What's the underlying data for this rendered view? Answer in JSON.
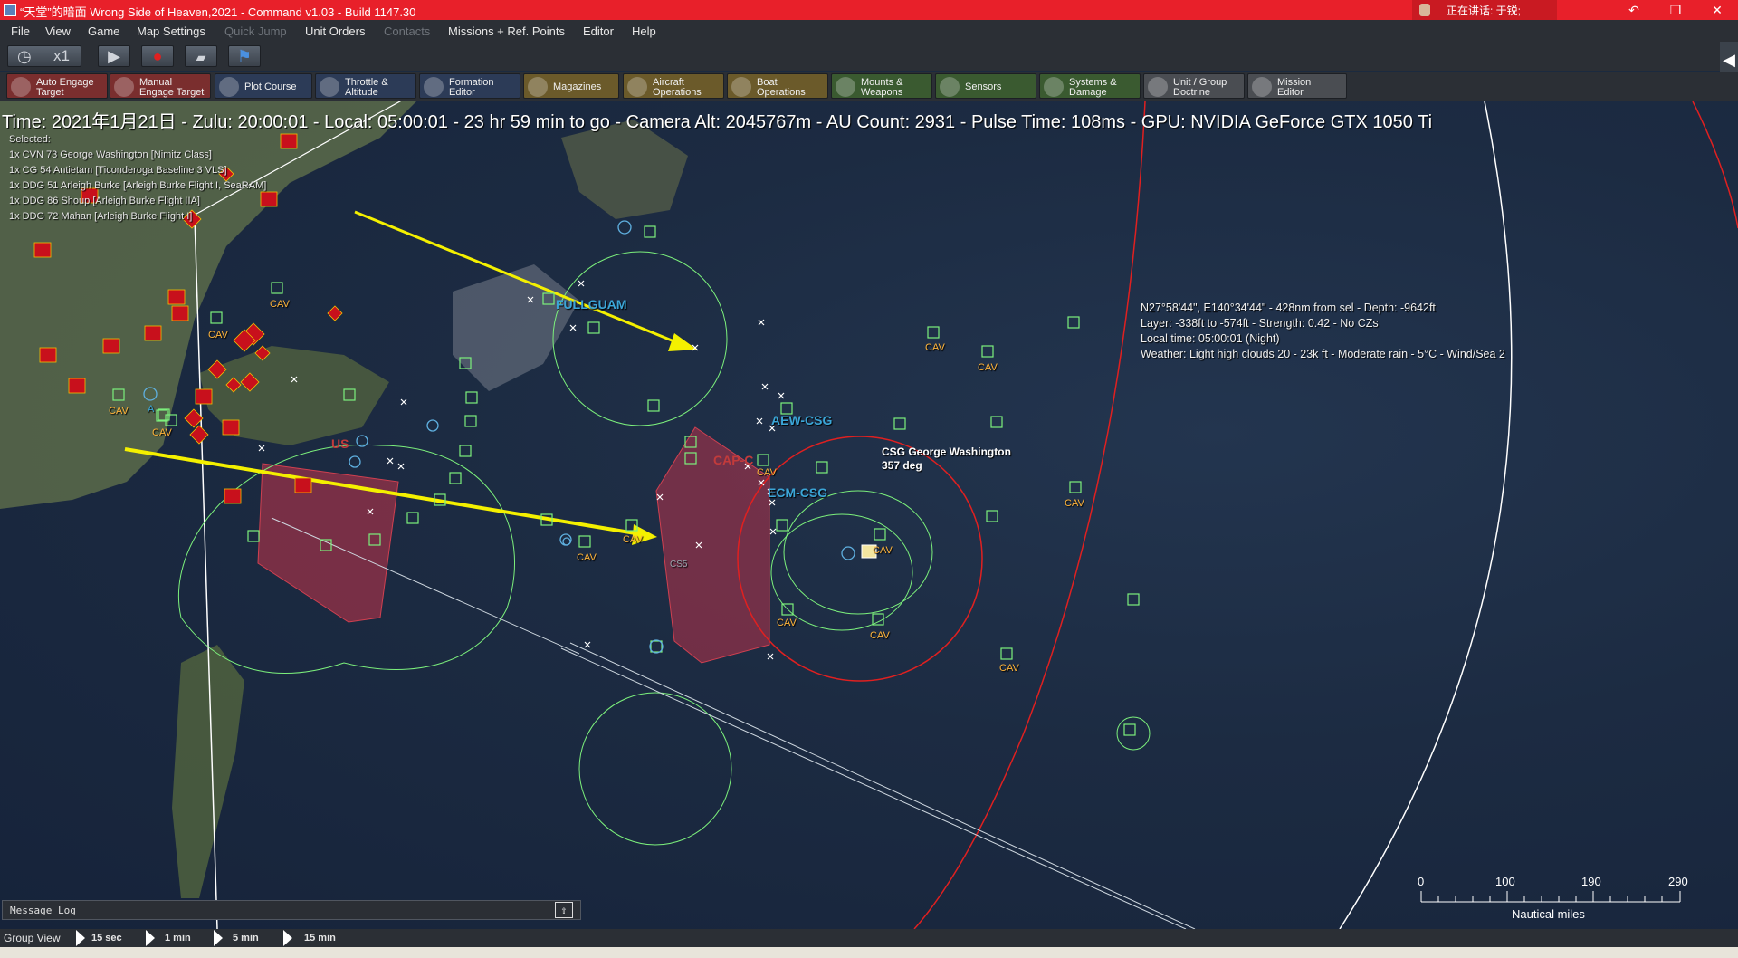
{
  "window": {
    "title": "“天堂”的暗面 Wrong Side of Heaven,2021 - Command v1.03 - Build 1147.30",
    "speaking_label": "正在讲话: 于锐;",
    "controls": [
      "↶",
      "❐",
      "✕"
    ]
  },
  "menu": {
    "items": [
      {
        "label": "File",
        "disabled": false
      },
      {
        "label": "View",
        "disabled": false
      },
      {
        "label": "Game",
        "disabled": false
      },
      {
        "label": "Map Settings",
        "disabled": false
      },
      {
        "label": "Quick Jump",
        "disabled": true
      },
      {
        "label": "Unit Orders",
        "disabled": false
      },
      {
        "label": "Contacts",
        "disabled": true
      },
      {
        "label": "Missions + Ref. Points",
        "disabled": false
      },
      {
        "label": "Editor",
        "disabled": false
      },
      {
        "label": "Help",
        "disabled": false
      }
    ]
  },
  "toolbar": {
    "speed": "x1",
    "clock_icon": "stopwatch-icon",
    "play_icon": "play-icon",
    "record_icon": "record-icon",
    "sidebar_toggle": "◀"
  },
  "commands": [
    {
      "label": "Auto Engage\nTarget",
      "icon": "crosshair-icon",
      "color": "#7a2e2e"
    },
    {
      "label": "Manual\nEngage Target",
      "icon": "crosshair-icon",
      "color": "#7a2e2e"
    },
    {
      "label": "Plot Course",
      "icon": "compass-icon",
      "color": "#2c3b57"
    },
    {
      "label": "Throttle &\nAltitude",
      "icon": "gear-icon",
      "color": "#2c3b57"
    },
    {
      "label": "Formation\nEditor",
      "icon": "formation-icon",
      "color": "#2c3b57"
    },
    {
      "label": "Magazines",
      "icon": "ammo-icon",
      "color": "#6b5a2a"
    },
    {
      "label": "Aircraft\nOperations",
      "icon": "aircraft-icon",
      "color": "#6b5a2a"
    },
    {
      "label": "Boat\nOperations",
      "icon": "boat-icon",
      "color": "#6b5a2a"
    },
    {
      "label": "Mounts &\nWeapons",
      "icon": "missile-icon",
      "color": "#3a5a30"
    },
    {
      "label": "Sensors",
      "icon": "radar-icon",
      "color": "#3a5a30"
    },
    {
      "label": "Systems &\nDamage",
      "icon": "cog-icon",
      "color": "#3a5a30"
    },
    {
      "label": "Unit / Group\nDoctrine",
      "icon": "document-icon",
      "color": "#4a4d52"
    },
    {
      "label": "Mission\nEditor",
      "icon": "list-icon",
      "color": "#4a4d52"
    }
  ],
  "status_line": "Time: 2021年1月21日 - Zulu: 20:00:01 - Local: 05:00:01 - 23 hr 59 min to go -  Camera Alt: 2045767m  - AU Count: 2931 - Pulse Time: 108ms - GPU: NVIDIA GeForce GTX 1050 Ti",
  "selected": {
    "heading": "Selected:",
    "units": [
      "1x CVN 73 George Washington [Nimitz Class]",
      "1x CG 54 Antietam [Ticonderoga Baseline 3 VLS]",
      "1x DDG 51 Arleigh Burke [Arleigh Burke Flight I, SeaRAM]",
      "1x DDG 86 Shoup [Arleigh Burke Flight IIA]",
      "1x DDG 72 Mahan [Arleigh Burke Flight I]"
    ]
  },
  "cursor_info": [
    "N27°58'44\", E140°34'44\" - 428nm from sel - Depth: -9642ft",
    "Layer: -338ft to -574ft - Strength: 0.42 - No CZs",
    "Local time: 05:00:01 (Night)",
    "Weather: Light high clouds 20 - 23k ft - Moderate rain - 5°C - Wind/Sea 2"
  ],
  "map_labels": {
    "cav": "CAV",
    "fullguam": "FULLGUAM",
    "aew": "AEW-CSG",
    "ecm": "ECM-CSG",
    "cap": "CAP-C",
    "unit_name": "CSG George Washington",
    "unit_heading": "357 deg",
    "cs5": "CS5",
    "red_us": "US",
    "a_label": "A"
  },
  "scale": {
    "ticks": [
      "0",
      "100",
      "190",
      "290"
    ],
    "unit": "Nautical miles"
  },
  "message_log": {
    "label": "Message Log",
    "icon": "expand-icon"
  },
  "bottom_bar": {
    "group_view": "Group View",
    "steps": [
      "15 sec",
      "1 min",
      "5 min",
      "15 min"
    ]
  },
  "colors": {
    "titlebar": "#e8202a",
    "friendly": "#7cf07c",
    "hostile": "#d11a1a",
    "range_ring": "#e02020",
    "zone_fill": "#b8334a",
    "arrow": "#f4f000",
    "group_label": "#3ba6d8",
    "cav_label": "#ffb43a"
  }
}
